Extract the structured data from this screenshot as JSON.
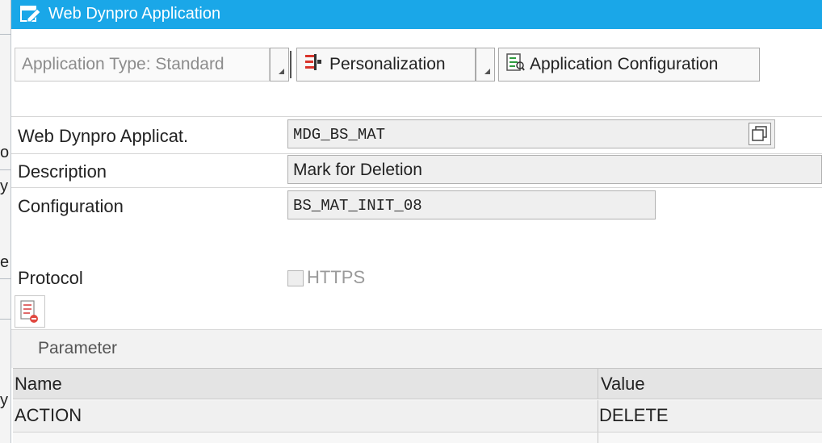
{
  "window": {
    "title": "Web Dynpro Application",
    "title_icon": "edit-window-icon"
  },
  "background_window": {
    "fragments": [
      "o",
      "y",
      "e",
      "y"
    ]
  },
  "toolbar": {
    "application_type": "Application Type: Standard",
    "personalization": "Personalization",
    "application_configuration": "Application Configuration"
  },
  "form": {
    "web_dynpro_application_label": "Web Dynpro Applicat.",
    "web_dynpro_application_value": "MDG_BS_MAT",
    "description_label": "Description",
    "description_value": "Mark for Deletion",
    "configuration_label": "Configuration",
    "configuration_value": "BS_MAT_INIT_08",
    "protocol_label": "Protocol",
    "https_label": "HTTPS",
    "https_checked": false
  },
  "parameters": {
    "section_title": "Parameter",
    "columns": [
      "Name",
      "Value"
    ],
    "rows": [
      {
        "name": "ACTION",
        "value": "DELETE"
      }
    ]
  },
  "colors": {
    "titlebar": "#1aa7e8",
    "field_background": "#efefef"
  }
}
